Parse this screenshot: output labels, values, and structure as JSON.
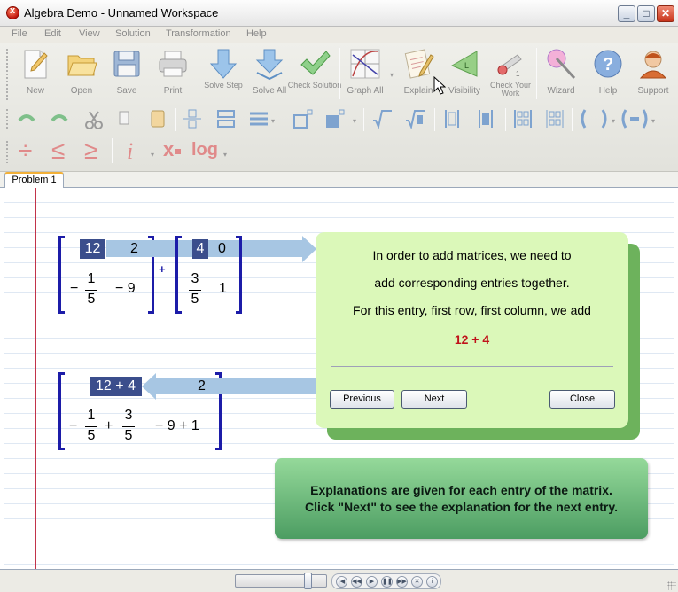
{
  "window": {
    "title": "Algebra Demo - Unnamed Workspace"
  },
  "menu": [
    "File",
    "Edit",
    "View",
    "Solution",
    "Transformation",
    "Help"
  ],
  "toolbar": {
    "new": "New",
    "open": "Open",
    "save": "Save",
    "print": "Print",
    "solve_step": "Solve Step",
    "solve_all": "Solve All",
    "check_solution": "Check Solution",
    "graph_all": "Graph All",
    "explain": "Explain",
    "visibility": "Visibility",
    "check_your_work": "Check Your Work",
    "wizard": "Wizard",
    "help": "Help",
    "support": "Support"
  },
  "tabs": [
    "Problem 1"
  ],
  "matrix_a": {
    "r1c1": "12",
    "r1c2": "2",
    "r2c1_sign": "−",
    "r2c1_num": "1",
    "r2c1_den": "5",
    "r2c2": "− 9"
  },
  "operator": "+",
  "matrix_b": {
    "r1c1": "4",
    "r1c2": "0",
    "r2c1_num": "3",
    "r2c1_den": "5",
    "r2c2": "1"
  },
  "result": {
    "r1c1": "12 + 4",
    "r1c2": "2",
    "r2_sign": "−",
    "r2_num1": "1",
    "r2_den1": "5",
    "r2_plus": "+",
    "r2_num2": "3",
    "r2_den2": "5",
    "r2c2": "− 9 + 1"
  },
  "explanation": {
    "line1": "In order to add matrices, we need to",
    "line2": "add corresponding entries together.",
    "line3": "For this entry, first row, first column, we add",
    "highlight": "12 + 4",
    "previous": "Previous",
    "next": "Next",
    "close": "Close"
  },
  "note": {
    "line1": "Explanations are given for each entry of the matrix.",
    "line2": "Click \"Next\" to see the explanation for the next entry."
  },
  "row2_symbols": {
    "divide": "÷",
    "le": "≤",
    "ge": "≥",
    "italic_i": "i",
    "subscript_x": "x",
    "log": "log"
  },
  "colors": {
    "matrix_bracket": "#1c1ca8",
    "highlight_cell": "#3b4e8c",
    "highlight_text": "#c0121a",
    "panel_bg": "#dbf8b9"
  }
}
